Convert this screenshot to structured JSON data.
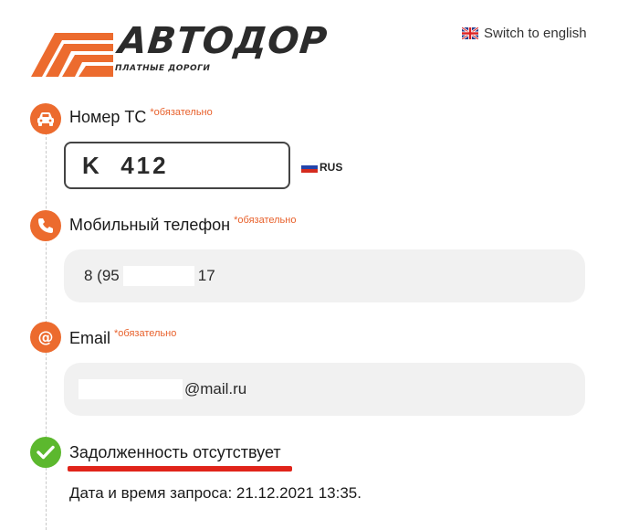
{
  "brand": {
    "name": "АВТОДОР",
    "tagline": "ПЛАТНЫЕ ДОРОГИ",
    "color": "#ec6b2e"
  },
  "header": {
    "switch_language": "Switch to english"
  },
  "vehicle": {
    "label": "Номер ТС",
    "required": "*обязательно",
    "plate_value": "K  412",
    "region_code": "RUS"
  },
  "phone": {
    "label": "Мобильный телефон",
    "required": "*обязательно",
    "value_prefix": "8 (95",
    "value_suffix": "17"
  },
  "email": {
    "label": "Email",
    "required": "*обязательно",
    "value_suffix": "@mail.ru"
  },
  "result": {
    "status": "Задолженность отсутствует",
    "request_date": "Дата и время запроса: 21.12.2021 13:35."
  },
  "colors": {
    "accent": "#ec6b2e",
    "success": "#5cb82e",
    "underline": "#e0241a"
  }
}
